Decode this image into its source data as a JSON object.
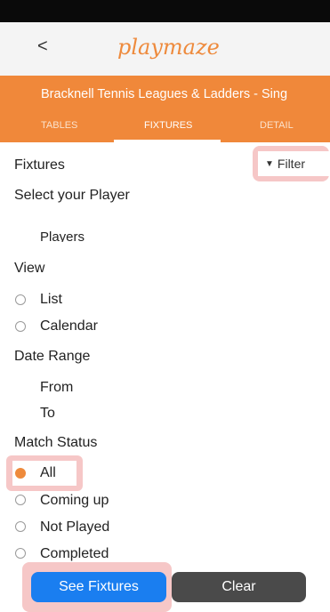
{
  "header": {
    "back_label": "<",
    "logo_text": "playmaze"
  },
  "league": {
    "title": "Bracknell Tennis Leagues & Ladders - Sing",
    "tabs": [
      {
        "label": "TABLES"
      },
      {
        "label": "FIXTURES",
        "active": true
      },
      {
        "label": "DETAIL"
      }
    ]
  },
  "fixtures": {
    "title": "Fixtures",
    "filter_label": "Filter",
    "select_player_label": "Select your Player",
    "players_placeholder": "Players"
  },
  "view": {
    "title": "View",
    "options": [
      {
        "label": "List",
        "checked": false
      },
      {
        "label": "Calendar",
        "checked": false
      }
    ]
  },
  "date_range": {
    "title": "Date Range",
    "from_label": "From",
    "to_label": "To"
  },
  "match_status": {
    "title": "Match Status",
    "options": [
      {
        "label": "All",
        "checked": true
      },
      {
        "label": "Coming up",
        "checked": false
      },
      {
        "label": "Not Played",
        "checked": false
      },
      {
        "label": "Completed",
        "checked": false
      }
    ]
  },
  "actions": {
    "see_fixtures_label": "See Fixtures",
    "clear_label": "Clear"
  },
  "colors": {
    "accent": "#f0883a",
    "primary_button": "#1a7ef0",
    "secondary_button": "#4a4a4a",
    "highlight": "#f6c7c7"
  }
}
